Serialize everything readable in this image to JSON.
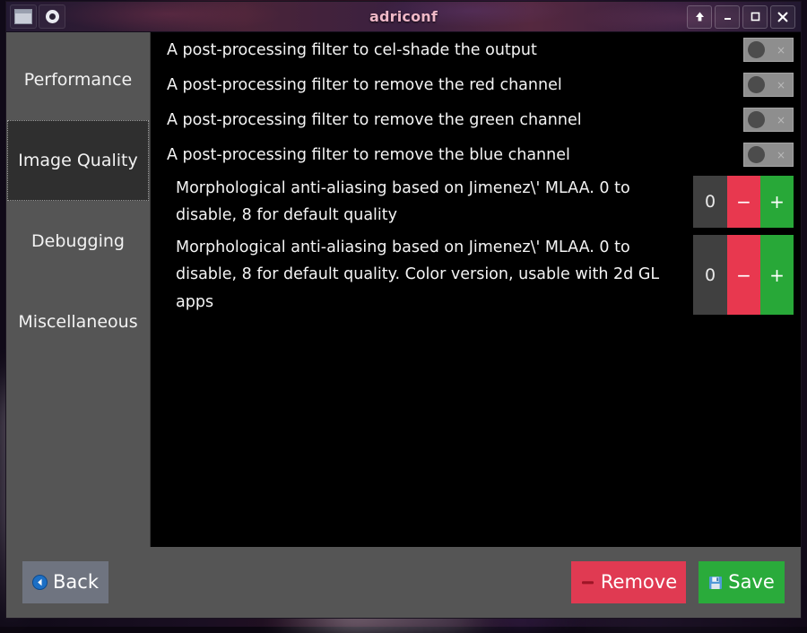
{
  "window": {
    "title": "adriconf",
    "titlebar_left_icons": [
      {
        "name": "window-menu-icon",
        "label": "window"
      },
      {
        "name": "app-menu-icon",
        "label": "menu"
      }
    ],
    "titlebar_buttons": [
      {
        "name": "shade-button",
        "glyph": "up-arrow"
      },
      {
        "name": "minimize-button",
        "glyph": "minimize"
      },
      {
        "name": "maximize-button",
        "glyph": "maximize"
      },
      {
        "name": "close-button",
        "glyph": "close"
      }
    ]
  },
  "sidebar": {
    "selected": "Image Quality",
    "items": [
      {
        "label": "Performance"
      },
      {
        "label": "Image Quality"
      },
      {
        "label": "Debugging"
      },
      {
        "label": "Miscellaneous"
      }
    ]
  },
  "main": {
    "rows": [
      {
        "type": "toggle",
        "description": "A post-processing filter to cel-shade the output",
        "value": "off",
        "x_mark": "×"
      },
      {
        "type": "toggle",
        "description": "A post-processing filter to remove the red channel",
        "value": "off",
        "x_mark": "×"
      },
      {
        "type": "toggle",
        "description": "A post-processing filter to remove the green channel",
        "value": "off",
        "x_mark": "×"
      },
      {
        "type": "toggle",
        "description": "A post-processing filter to remove the blue channel",
        "value": "off",
        "x_mark": "×"
      },
      {
        "type": "spinner",
        "description": "Morphological anti-aliasing based on Jimenez\\' MLAA. 0 to disable, 8 for default quality",
        "value": "0",
        "minus_label": "−",
        "plus_label": "+"
      },
      {
        "type": "spinner",
        "description": "Morphological anti-aliasing based on Jimenez\\' MLAA. 0 to disable, 8 for default quality. Color version, usable with 2d GL apps",
        "value": "0",
        "minus_label": "−",
        "plus_label": "+"
      }
    ]
  },
  "footer": {
    "back_label": "Back",
    "remove_label": "Remove",
    "save_label": "Save"
  },
  "colors": {
    "titlebar_title": "#f0b8c8",
    "window_chrome": "#555555",
    "content_bg": "#000000",
    "selected_tab_bg": "#2f2f2f",
    "spinner_minus": "#e8384f",
    "spinner_plus": "#28a838",
    "remove_button": "#e03a52",
    "save_button": "#2aab3b",
    "back_button": "#6f7480",
    "toggle_track": "#8e8e8e",
    "toggle_knob": "#4c4c4c"
  }
}
